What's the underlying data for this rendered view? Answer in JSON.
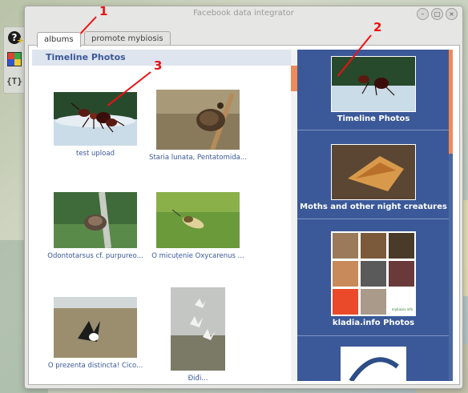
{
  "window": {
    "title": "Facebook data integrator",
    "min_label": "–",
    "max_label": "□",
    "close_label": "×"
  },
  "dock": {
    "help_label": "?",
    "text_label": "{T}"
  },
  "tabs": [
    {
      "label": "albums"
    },
    {
      "label": "promote mybiosis"
    }
  ],
  "album_header": "Timeline Photos",
  "photos": [
    {
      "caption": "test upload"
    },
    {
      "caption": "Staria lunata, Pentatomida..."
    },
    {
      "caption": "Odontotarsus cf. purpureo..."
    },
    {
      "caption": "O micuțenie Oxycarenus ..."
    },
    {
      "caption": "O prezenta distincta! Cico..."
    },
    {
      "caption": "Điđi..."
    }
  ],
  "albums": [
    {
      "name": "Timeline Photos"
    },
    {
      "name": "Moths and other night creatures"
    },
    {
      "name": "kladia.info Photos"
    },
    {
      "name": ""
    }
  ],
  "kladia_watermark": "mybiosis.info",
  "annotations": [
    "1",
    "2",
    "3"
  ],
  "colors": {
    "accent": "#3b5998",
    "scroll_accent": "#f08a5a",
    "annotation": "#ee1111"
  }
}
